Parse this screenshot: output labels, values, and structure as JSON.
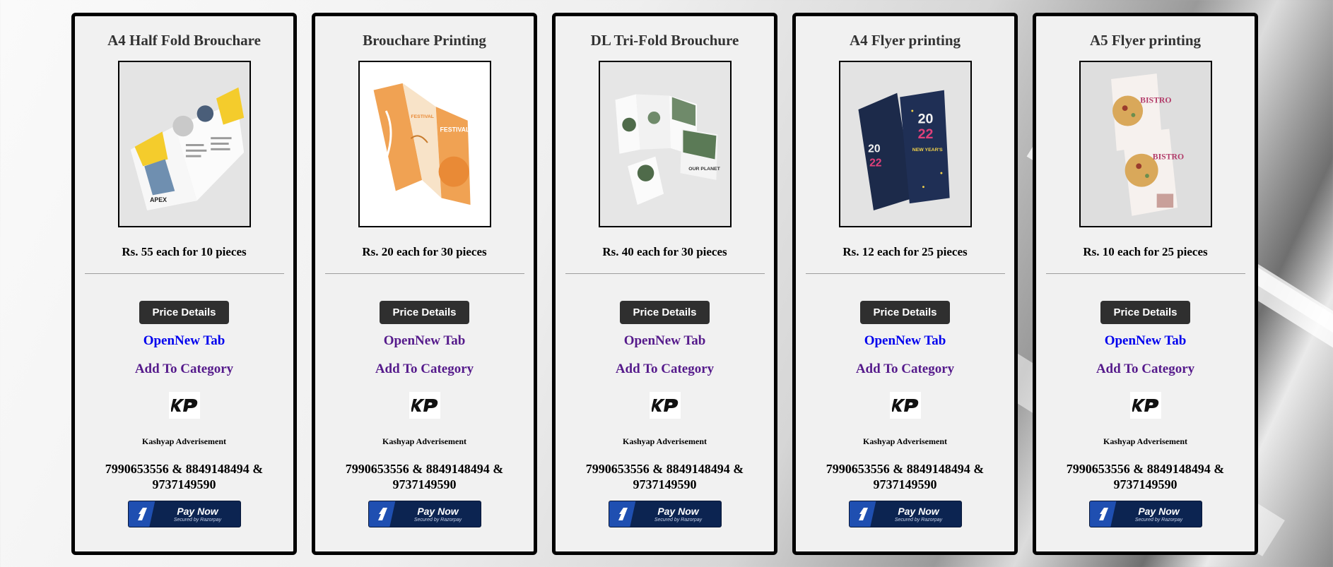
{
  "cards": [
    {
      "title": "A4 Half Fold Brouchare",
      "price": "Rs. 55 each for 10 pieces",
      "details_label": "Price Details",
      "open_tab_label": "OpenNew Tab",
      "open_tab_color": "#0000ee",
      "category_label": "Add To Category",
      "company": "Kashyap Adverisement",
      "phones": "7990653556 & 8849148494 & 9737149590",
      "pay_label": "Pay Now",
      "pay_sub": "Secured by Razorpay",
      "image": "half-fold-brochure"
    },
    {
      "title": "Brouchare Printing",
      "price": "Rs. 20 each for 30 pieces",
      "details_label": "Price Details",
      "open_tab_label": "OpenNew Tab",
      "open_tab_color": "#551a8b",
      "category_label": "Add To Category",
      "company": "Kashyap Adverisement",
      "phones": "7990653556 & 8849148494 & 9737149590",
      "pay_label": "Pay Now",
      "pay_sub": "Secured by Razorpay",
      "image": "festival-brochure"
    },
    {
      "title": "DL Tri-Fold Brouchure",
      "price": "Rs. 40 each for 30 pieces",
      "details_label": "Price Details",
      "open_tab_label": "OpenNew Tab",
      "open_tab_color": "#551a8b",
      "category_label": "Add To Category",
      "company": "Kashyap Adverisement",
      "phones": "7990653556 & 8849148494 & 9737149590",
      "pay_label": "Pay Now",
      "pay_sub": "Secured by Razorpay",
      "image": "tri-fold-brochure"
    },
    {
      "title": "A4 Flyer printing",
      "price": "Rs. 12 each for 25 pieces",
      "details_label": "Price Details",
      "open_tab_label": "OpenNew Tab",
      "open_tab_color": "#0000ee",
      "category_label": "Add To Category",
      "company": "Kashyap Adverisement",
      "phones": "7990653556 & 8849148494 & 9737149590",
      "pay_label": "Pay Now",
      "pay_sub": "Secured by Razorpay",
      "image": "new-year-flyer"
    },
    {
      "title": "A5 Flyer printing",
      "price": "Rs. 10 each for 25 pieces",
      "details_label": "Price Details",
      "open_tab_label": "OpenNew Tab",
      "open_tab_color": "#0000ee",
      "category_label": "Add To Category",
      "company": "Kashyap Adverisement",
      "phones": "7990653556 & 8849148494 & 9737149590",
      "pay_label": "Pay Now",
      "pay_sub": "Secured by Razorpay",
      "image": "bistro-flyer"
    }
  ],
  "colors": {
    "card_border": "#000000",
    "button_bg": "#2f2f2f",
    "category_link": "#551a8b",
    "pay_bg": "#0c2451"
  }
}
